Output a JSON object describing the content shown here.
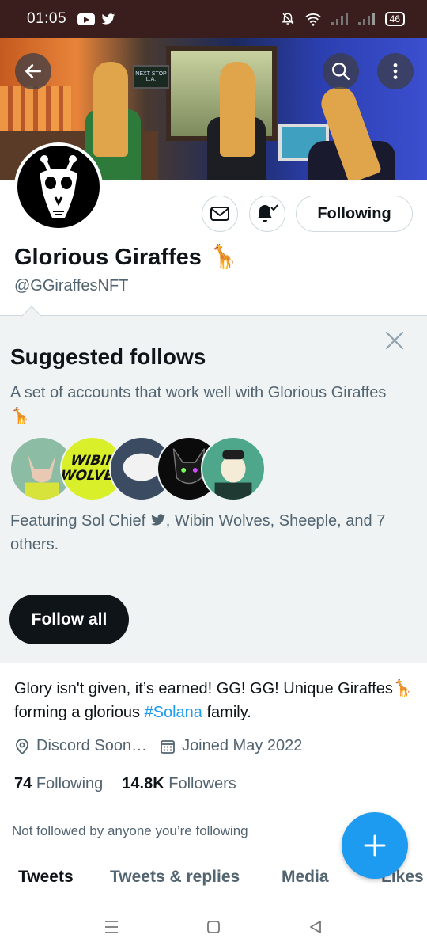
{
  "status_bar": {
    "time": "01:05",
    "battery": "46"
  },
  "profile": {
    "display_name": "Glorious Giraffes",
    "name_emoji": "🦒",
    "handle": "@GGiraffesNFT",
    "following_button": "Following",
    "banner_sign": "NEXT STOP L.A.",
    "bio_part1": "Glory isn't given, it’s earned! GG! GG! Unique Giraffes",
    "bio_emoji": "🦒",
    "bio_part2": " forming a glorious ",
    "bio_hashtag": "#Solana",
    "bio_part3": " family.",
    "location": "Discord Soon…",
    "joined": "Joined May 2022",
    "following_count": "74",
    "following_label": "Following",
    "followers_count": "14.8K",
    "followers_label": "Followers",
    "not_followed": "Not followed by anyone you’re following"
  },
  "suggested": {
    "title": "Suggested follows",
    "description": "A set of accounts that work well with Glorious Giraffes",
    "description_emoji": "🦒",
    "featuring_prefix": "Featuring Sol Chief",
    "featuring_suffix": ", Wibin Wolves, Sheeple, and 7 others.",
    "avatar2_text_line1": "WIBIN",
    "avatar2_text_line2": "WOLVES",
    "follow_all_label": "Follow all"
  },
  "tabs": [
    "Tweets",
    "Tweets & replies",
    "Media",
    "Likes"
  ],
  "colors": {
    "accent": "#1d9bf0",
    "text_primary": "#0f1419",
    "text_secondary": "#536471",
    "panel_bg": "#eff3f4",
    "status_bar_bg": "#3a1e1e"
  },
  "icons": [
    "back-arrow-icon",
    "search-icon",
    "more-vertical-icon",
    "mail-icon",
    "bell-check-icon",
    "close-icon",
    "location-pin-icon",
    "calendar-icon",
    "twitter-bird-icon",
    "compose-plus-icon",
    "nav-menu-icon",
    "nav-home-icon",
    "nav-back-icon"
  ]
}
